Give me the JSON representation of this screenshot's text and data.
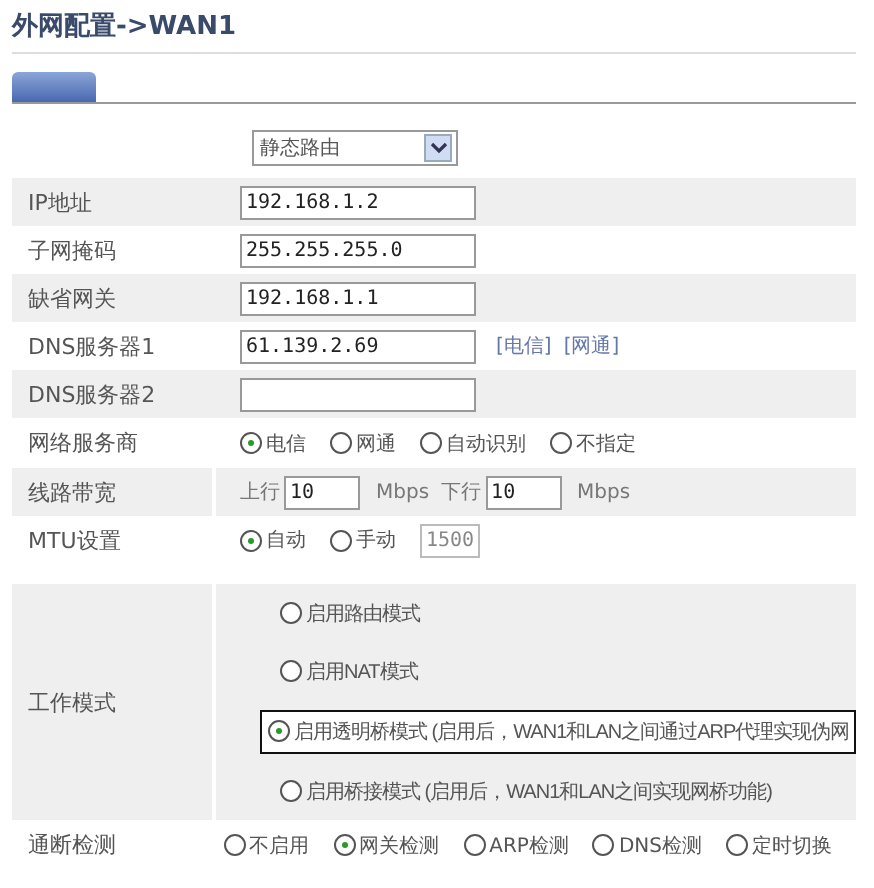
{
  "title": "外网配置->WAN1",
  "tab": {
    "selected": true
  },
  "rows": [
    {
      "kind": "select",
      "value": "静态路由"
    },
    {
      "kind": "text",
      "label": "IP地址",
      "value": "192.168.1.2"
    },
    {
      "kind": "text",
      "label": "子网掩码",
      "value": "255.255.255.0"
    },
    {
      "kind": "text",
      "label": "缺省网关",
      "value": "192.168.1.1"
    },
    {
      "kind": "text",
      "label": "DNS服务器1",
      "value": "61.139.2.69",
      "links": [
        "[电信]",
        "[网通]"
      ]
    },
    {
      "kind": "text",
      "label": "DNS服务器2"
    },
    {
      "kind": "radio",
      "label": "网络服务商",
      "options": [
        {
          "label": "电信",
          "selected": true
        },
        {
          "label": "网通",
          "selected": false
        },
        {
          "label": "自动识别",
          "selected": false
        },
        {
          "label": "不指定",
          "selected": false
        }
      ]
    },
    {
      "kind": "bandwidth",
      "label": "线路带宽",
      "up_label": "上行",
      "up_value": "10",
      "up_unit": "Mbps",
      "down_label": "下行",
      "down_value": "10",
      "down_unit": "Mbps"
    },
    {
      "kind": "mtu",
      "label": "MTU设置",
      "options": [
        {
          "label": "自动",
          "selected": true
        },
        {
          "label": "手动",
          "selected": false
        }
      ],
      "field": {
        "value": "1500",
        "disabled": true
      }
    },
    {
      "kind": "radio_list",
      "label": "工作模式",
      "options": [
        {
          "label": "启用路由模式",
          "selected": false,
          "highlighted": false
        },
        {
          "label": "启用NAT模式",
          "selected": false,
          "highlighted": false
        },
        {
          "label": "启用透明桥模式 (启用后，WAN1和LAN之间通过ARP代理实现伪网",
          "selected": true,
          "highlighted": true
        },
        {
          "label": "启用桥接模式 (启用后，WAN1和LAN之间实现网桥功能)",
          "selected": false,
          "highlighted": false
        }
      ]
    },
    {
      "kind": "radio",
      "label": "通断检测",
      "options": [
        {
          "label": "不启用",
          "selected": false
        },
        {
          "label": "网关检测",
          "selected": true
        },
        {
          "label": "ARP检测",
          "selected": false
        },
        {
          "label": "DNS检测",
          "selected": false
        },
        {
          "label": "定时切换",
          "selected": false
        }
      ]
    }
  ]
}
